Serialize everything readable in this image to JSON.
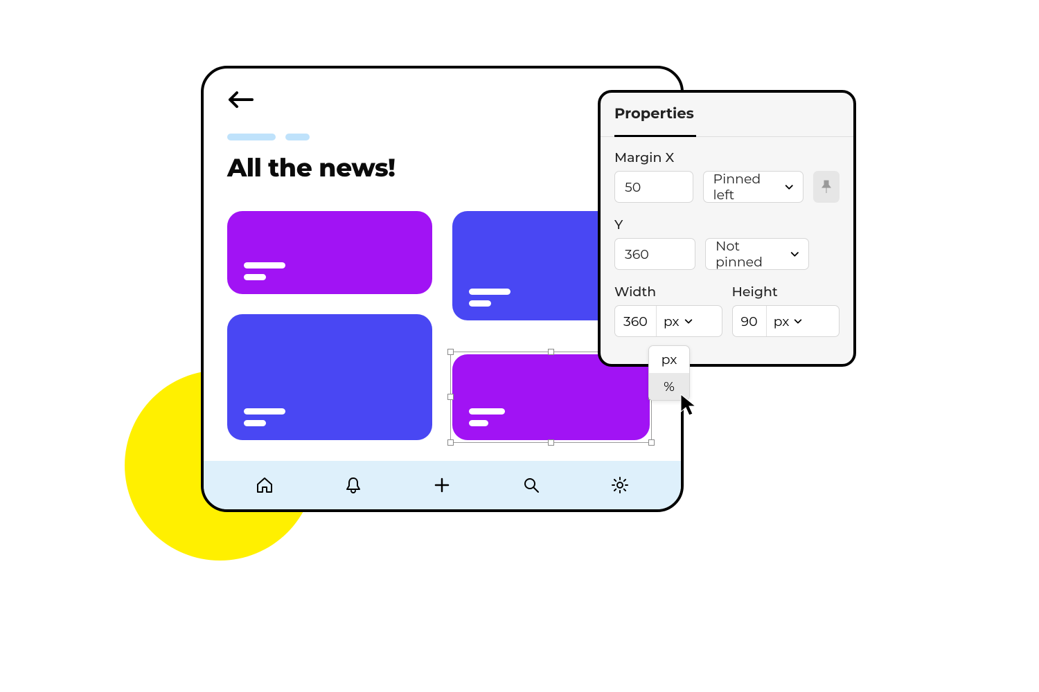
{
  "app": {
    "title": "All the news!"
  },
  "properties": {
    "panel_title": "Properties",
    "margin_x_label": "Margin X",
    "margin_x_value": "50",
    "margin_x_pin": "Pinned left",
    "y_label": "Y",
    "y_value": "360",
    "y_pin": "Not pinned",
    "width_label": "Width",
    "width_value": "360",
    "width_unit": "px",
    "height_label": "Height",
    "height_value": "90",
    "height_unit": "px",
    "unit_options": {
      "px": "px",
      "pct": "%"
    }
  },
  "colors": {
    "purple": "#A113F4",
    "blue": "#4947F3",
    "yellow": "#FDEB00",
    "tabbar": "#DEF0FB",
    "crumb": "#BFE2FB"
  }
}
